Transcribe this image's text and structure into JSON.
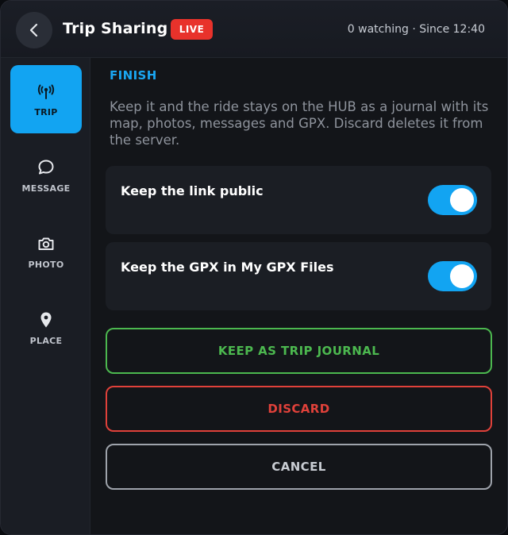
{
  "header": {
    "title": "Trip Sharing",
    "live_badge": "LIVE",
    "status": "0 watching · Since 12:40"
  },
  "sidebar": {
    "items": [
      {
        "label": "TRIP",
        "icon": "broadcast-icon",
        "active": true
      },
      {
        "label": "MESSAGE",
        "icon": "chat-bubble-icon",
        "active": false
      },
      {
        "label": "PHOTO",
        "icon": "camera-icon",
        "active": false
      },
      {
        "label": "PLACE",
        "icon": "map-pin-icon",
        "active": false
      }
    ]
  },
  "main": {
    "section_title": "FINISH",
    "description": "Keep it and the ride stays on the HUB as a journal with its map, photos, messages and GPX. Discard deletes it from the server.",
    "toggles": [
      {
        "label": "Keep the link public",
        "on": true
      },
      {
        "label": "Keep the GPX in My GPX Files",
        "on": true
      }
    ],
    "buttons": {
      "keep": "KEEP AS TRIP JOURNAL",
      "discard": "DISCARD",
      "cancel": "CANCEL"
    }
  },
  "colors": {
    "accent": "#12a4f2",
    "live": "#e8322b",
    "keep": "#4cb84f",
    "discard": "#e0413a",
    "cancel": "#9ea3ab"
  }
}
